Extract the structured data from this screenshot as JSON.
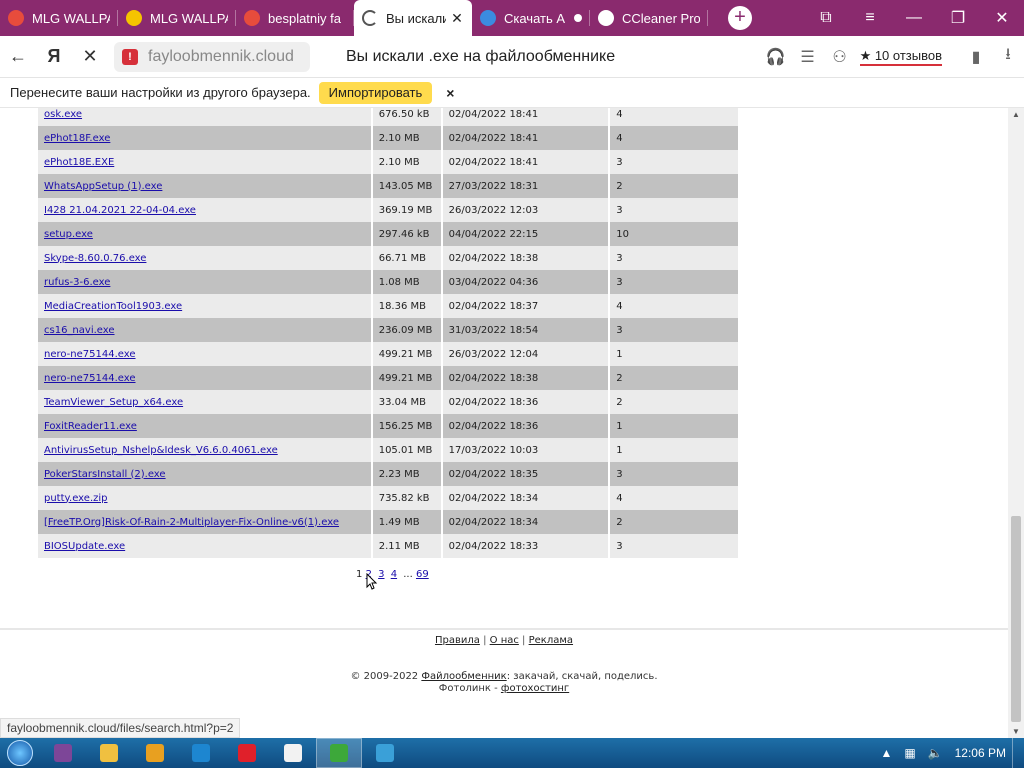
{
  "tabs": [
    {
      "title": "MLG WALLPA",
      "icon": "yandex-icon",
      "color": "#e74c3c"
    },
    {
      "title": "MLG WALLPA",
      "icon": "yandex-images-icon",
      "color": "#f5c400"
    },
    {
      "title": "besplatniy fa",
      "icon": "yandex-icon",
      "color": "#e74c3c"
    },
    {
      "title": "Вы искали",
      "icon": "loading-icon",
      "active": true
    },
    {
      "title": "Скачать А",
      "icon": "edge-icon",
      "color": "#3b8be0",
      "dot": true
    },
    {
      "title": "CCleaner Pro",
      "icon": "ccleaner-icon",
      "color": "#fff"
    }
  ],
  "address": {
    "url": "fayloobmennik.cloud",
    "page_title": "Вы искали .exe на файлообменнике",
    "reviews": "★ 10 отзывов"
  },
  "infobar": {
    "text": "Перенесите ваши настройки из другого браузера.",
    "button": "Импортировать",
    "close": "×"
  },
  "files": [
    {
      "name": "osk.exe",
      "size": "676.50 kB",
      "date": "02/04/2022 18:41",
      "downloads": "4"
    },
    {
      "name": "ePhot18F.exe",
      "size": "2.10 MB",
      "date": "02/04/2022 18:41",
      "downloads": "4"
    },
    {
      "name": "ePhot18E.EXE",
      "size": "2.10 MB",
      "date": "02/04/2022 18:41",
      "downloads": "3"
    },
    {
      "name": "WhatsAppSetup (1).exe",
      "size": "143.05 MB",
      "date": "27/03/2022 18:31",
      "downloads": "2"
    },
    {
      "name": "I428 21.04.2021 22-04-04.exe",
      "size": "369.19 MB",
      "date": "26/03/2022 12:03",
      "downloads": "3"
    },
    {
      "name": "setup.exe",
      "size": "297.46 kB",
      "date": "04/04/2022 22:15",
      "downloads": "10"
    },
    {
      "name": "Skype-8.60.0.76.exe",
      "size": "66.71 MB",
      "date": "02/04/2022 18:38",
      "downloads": "3"
    },
    {
      "name": "rufus-3-6.exe",
      "size": "1.08 MB",
      "date": "03/04/2022 04:36",
      "downloads": "3"
    },
    {
      "name": "MediaCreationTool1903.exe",
      "size": "18.36 MB",
      "date": "02/04/2022 18:37",
      "downloads": "4"
    },
    {
      "name": "cs16_navi.exe",
      "size": "236.09 MB",
      "date": "31/03/2022 18:54",
      "downloads": "3"
    },
    {
      "name": "nero-ne75144.exe",
      "size": "499.21 MB",
      "date": "26/03/2022 12:04",
      "downloads": "1"
    },
    {
      "name": "nero-ne75144.exe",
      "size": "499.21 MB",
      "date": "02/04/2022 18:38",
      "downloads": "2"
    },
    {
      "name": "TeamViewer_Setup_x64.exe",
      "size": "33.04 MB",
      "date": "02/04/2022 18:36",
      "downloads": "2"
    },
    {
      "name": "FoxitReader11.exe",
      "size": "156.25 MB",
      "date": "02/04/2022 18:36",
      "downloads": "1"
    },
    {
      "name": "AntivirusSetup_Nshelp&Idesk_V6.6.0.4061.exe",
      "size": "105.01 MB",
      "date": "17/03/2022 10:03",
      "downloads": "1"
    },
    {
      "name": "PokerStarsInstall (2).exe",
      "size": "2.23 MB",
      "date": "02/04/2022 18:35",
      "downloads": "3"
    },
    {
      "name": "putty.exe.zip",
      "size": "735.82 kB",
      "date": "02/04/2022 18:34",
      "downloads": "4"
    },
    {
      "name": "[FreeTP.Org]Risk-Of-Rain-2-Multiplayer-Fix-Online-v6(1).exe",
      "size": "1.49 MB",
      "date": "02/04/2022 18:34",
      "downloads": "2"
    },
    {
      "name": "BIOSUpdate.exe",
      "size": "2.11 MB",
      "date": "02/04/2022 18:33",
      "downloads": "3"
    }
  ],
  "pager": {
    "current": "1",
    "pages": [
      "2",
      "3",
      "4"
    ],
    "ellipsis": "...",
    "last": "69"
  },
  "footer": {
    "links": [
      "Правила",
      "О нас",
      "Реклама"
    ],
    "separator": "|",
    "copyright_prefix": "© 2009-2022",
    "site_link": "Файлообменник",
    "slogan": ": закачай, скачай, поделись.",
    "photo_prefix": "Фотолинк -",
    "photo_link": "фотохостинг"
  },
  "status_url": "fayloobmennik.cloud/files/search.html?p=2",
  "taskbar": {
    "apps": [
      {
        "icon": "tor-icon",
        "color": "#7d4698"
      },
      {
        "icon": "explorer-icon",
        "color": "#f0c040"
      },
      {
        "icon": "media-player-icon",
        "color": "#e8a020"
      },
      {
        "icon": "ccleaner-icon",
        "color": "#1d86d0"
      },
      {
        "icon": "opera-icon",
        "color": "#e0202a"
      },
      {
        "icon": "yandex-browser-icon",
        "color": "#f2f2f2"
      },
      {
        "icon": "green-app-icon",
        "color": "#3da83a",
        "active": true
      },
      {
        "icon": "network-app-icon",
        "color": "#3aa0d8"
      }
    ],
    "clock": "12:06 PM"
  }
}
